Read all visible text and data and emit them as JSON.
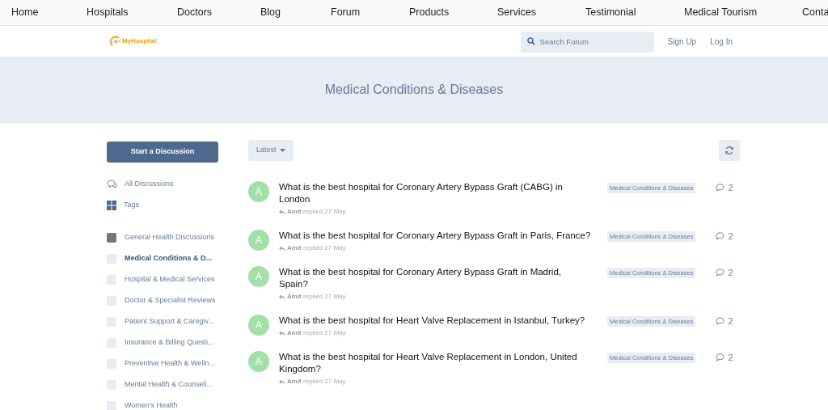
{
  "top_nav": [
    {
      "label": "Home"
    },
    {
      "label": "Hospitals"
    },
    {
      "label": "Doctors"
    },
    {
      "label": "Blog"
    },
    {
      "label": "Forum"
    },
    {
      "label": "Products"
    },
    {
      "label": "Services"
    },
    {
      "label": "Testimonial"
    },
    {
      "label": "Medical Tourism"
    },
    {
      "label": "Conta"
    }
  ],
  "header": {
    "logo": "MyHospital",
    "search": {
      "placeholder": "Search Forum"
    },
    "links": [
      "Sign Up",
      "Log In"
    ]
  },
  "hero": {
    "title": "Medical Conditions & Diseases"
  },
  "sidebar": {
    "start_button": "Start a Discussion",
    "nav": [
      {
        "kind": "discussions",
        "label": "All Discussions"
      },
      {
        "kind": "tags",
        "label": "Tags"
      }
    ],
    "categories": [
      {
        "label": "General Health Discussions",
        "color": "#777777",
        "selected": false
      },
      {
        "label": "Medical Conditions & D...",
        "color": "#e8ecf3",
        "selected": true
      },
      {
        "label": "Hospital & Medical Services",
        "color": "#e8ecf3",
        "selected": false
      },
      {
        "label": "Doctor & Specialist Reviews",
        "color": "#e8ecf3",
        "selected": false
      },
      {
        "label": "Patient Support & Caregiv...",
        "color": "#e8ecf3",
        "selected": false
      },
      {
        "label": "Insurance & Billing Questi...",
        "color": "#e8ecf3",
        "selected": false
      },
      {
        "label": "Preventive Health & Welln...",
        "color": "#e8ecf3",
        "selected": false
      },
      {
        "label": "Mental Health & Counseli...",
        "color": "#e8ecf3",
        "selected": false
      },
      {
        "label": "Women's Health",
        "color": "#e8ecf3",
        "selected": false
      }
    ]
  },
  "toolbar": {
    "sort": "Latest"
  },
  "discussions": [
    {
      "avatar": "A",
      "title": "What is the best hospital for Coronary Artery Bypass Graft (CABG) in London",
      "user": "Amit",
      "action": "replied 27 May",
      "tag": "Medical Conditions & Diseases",
      "replies": "2"
    },
    {
      "avatar": "A",
      "title": "What is the best hospital for Coronary Artery Bypass Graft in Paris, France?",
      "user": "Amit",
      "action": "replied 27 May",
      "tag": "Medical Conditions & Diseases",
      "replies": "2"
    },
    {
      "avatar": "A",
      "title": "What is the best hospital for Coronary Artery Bypass Graft in Madrid, Spain?",
      "user": "Amit",
      "action": "replied 27 May",
      "tag": "Medical Conditions & Diseases",
      "replies": "2"
    },
    {
      "avatar": "A",
      "title": "What is the best hospital for Heart Valve Replacement in Istanbul, Turkey?",
      "user": "Amit",
      "action": "replied 27 May",
      "tag": "Medical Conditions & Diseases",
      "replies": "2"
    },
    {
      "avatar": "A",
      "title": "What is the best hospital for Heart Valve Replacement in London, United Kingdom?",
      "user": "Amit",
      "action": "replied 27 May",
      "tag": "Medical Conditions & Diseases",
      "replies": "2"
    }
  ]
}
